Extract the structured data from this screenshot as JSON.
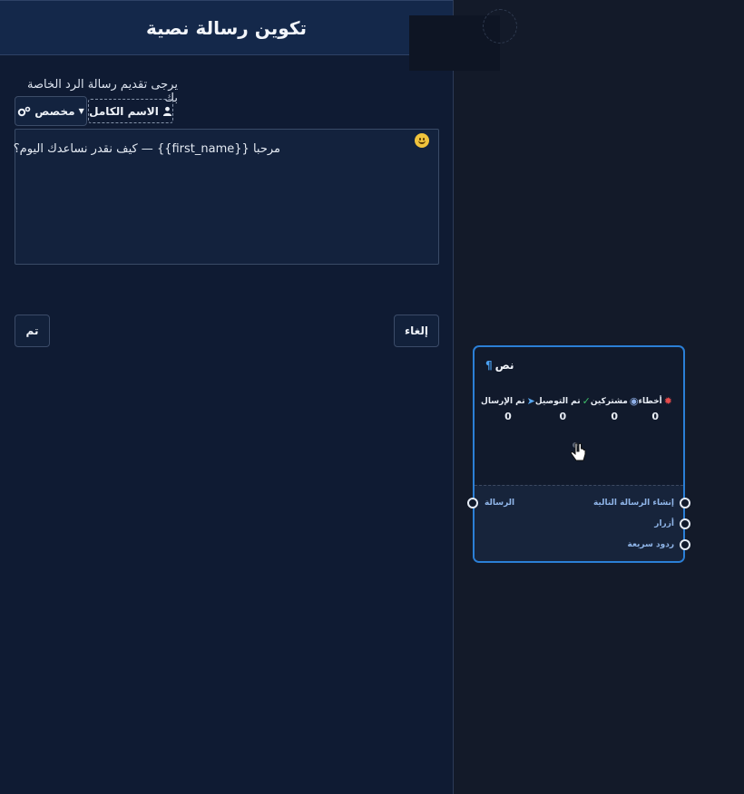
{
  "panel": {
    "title": "تكوين رسالة نصية",
    "prompt": "يرجى تقديم رسالة الرد الخاصة بك",
    "variable_button": "الاسم الكامل",
    "custom_button": "مخصص",
    "message": "مرحبا {{first_name}} — كيف نقدر نساعدك اليوم؟",
    "done_button": "تم",
    "cancel_button": "إلغاء"
  },
  "node": {
    "title": "نص",
    "stats": [
      {
        "label": "أخطاء",
        "value": "0",
        "icon": "bug-icon"
      },
      {
        "label": "مشتركين",
        "value": "0",
        "icon": "user-circle-icon"
      },
      {
        "label": "تم التوصيل",
        "value": "0",
        "icon": "check-circle-icon"
      },
      {
        "label": "تم الإرسال",
        "value": "0",
        "icon": "paper-plane-icon"
      }
    ],
    "input_label": "الرسالة",
    "outputs": [
      "إنشاء الرسالة التالية",
      "أزرار",
      "ردود سريعة"
    ]
  },
  "colors": {
    "accent": "#2b7fd6",
    "error": "#e54b4b",
    "success": "#3fbf6a"
  }
}
